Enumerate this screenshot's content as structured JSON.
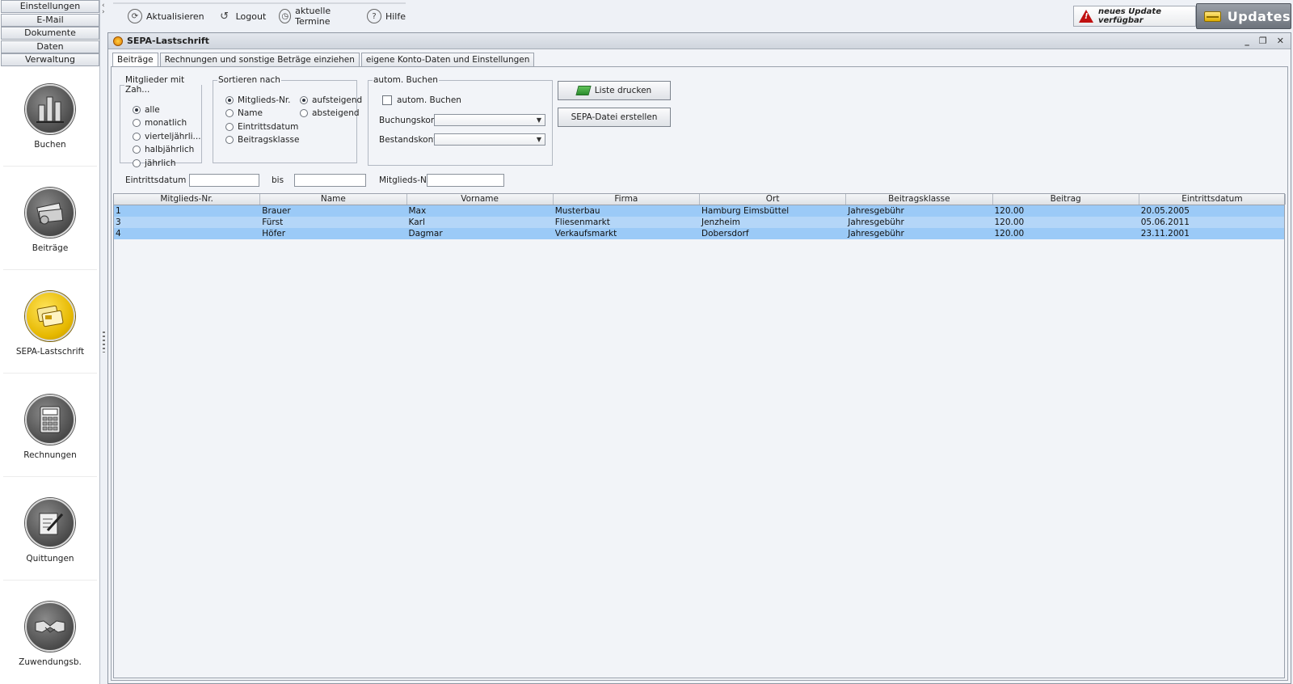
{
  "menu": [
    "Einstellungen",
    "E-Mail",
    "Dokumente",
    "Daten",
    "Verwaltung"
  ],
  "modules": [
    {
      "label": "Buchen",
      "icon": "bar-chart-icon"
    },
    {
      "label": "Beiträge",
      "icon": "money-icon"
    },
    {
      "label": "SEPA-Lastschrift",
      "icon": "bank-card-icon"
    },
    {
      "label": "Rechnungen",
      "icon": "calculator-icon"
    },
    {
      "label": "Quittungen",
      "icon": "pen-paper-icon"
    },
    {
      "label": "Zuwendungsb.",
      "icon": "handshake-icon"
    }
  ],
  "toolbar": {
    "refresh": "Aktualisieren",
    "logout": "Logout",
    "appointments": "aktuelle Termine",
    "help": "Hilfe"
  },
  "update_note": "neues Update verfügbar",
  "updates_button": "Updates",
  "window": {
    "title": "SEPA-Lastschrift",
    "controls": [
      "_",
      "❐",
      "✕"
    ]
  },
  "tabs": [
    "Beiträge",
    "Rechnungen und sonstige Beträge einziehen",
    "eigene Konto-Daten und Einstellungen"
  ],
  "filter": {
    "members_legend": "Mitglieder mit Zah...",
    "members_options": [
      "alle",
      "monatlich",
      "vierteljährli...",
      "halbjährlich",
      "jährlich"
    ],
    "members_selected": 0,
    "sort_legend": "Sortieren nach",
    "sort_options": [
      "Mitglieds-Nr.",
      "Name",
      "Eintrittsdatum",
      "Beitragsklasse"
    ],
    "sort_selected": 0,
    "order_options": [
      "aufsteigend",
      "absteigend"
    ],
    "order_selected": 0,
    "auto_legend": "autom. Buchen",
    "auto_checkbox": "autom. Buchen",
    "auto_checked": false,
    "booking_account_label": "Buchungskonto",
    "stock_account_label": "Bestandskonto",
    "print_button": "Liste drucken",
    "sepa_button": "SEPA-Datei erstellen",
    "date_from_label": "Eintrittsdatum ab",
    "date_to_label": "bis",
    "member_no_label": "Mitglieds-Nr.",
    "date_from_value": "",
    "date_to_value": "",
    "member_no_value": ""
  },
  "table": {
    "headers": [
      "Mitglieds-Nr.",
      "Name",
      "Vorname",
      "Firma",
      "Ort",
      "Beitragsklasse",
      "Beitrag",
      "Eintrittsdatum"
    ],
    "rows": [
      [
        "1",
        "Brauer",
        "Max",
        "Musterbau",
        "Hamburg Eimsbüttel",
        "Jahresgebühr",
        "120.00",
        "20.05.2005"
      ],
      [
        "3",
        "Fürst",
        "Karl",
        "Fliesenmarkt",
        "Jenzheim",
        "Jahresgebühr",
        "120.00",
        "05.06.2011"
      ],
      [
        "4",
        "Höfer",
        "Dagmar",
        "Verkaufsmarkt",
        "Dobersdorf",
        "Jahresgebühr",
        "120.00",
        "23.11.2001"
      ]
    ]
  }
}
